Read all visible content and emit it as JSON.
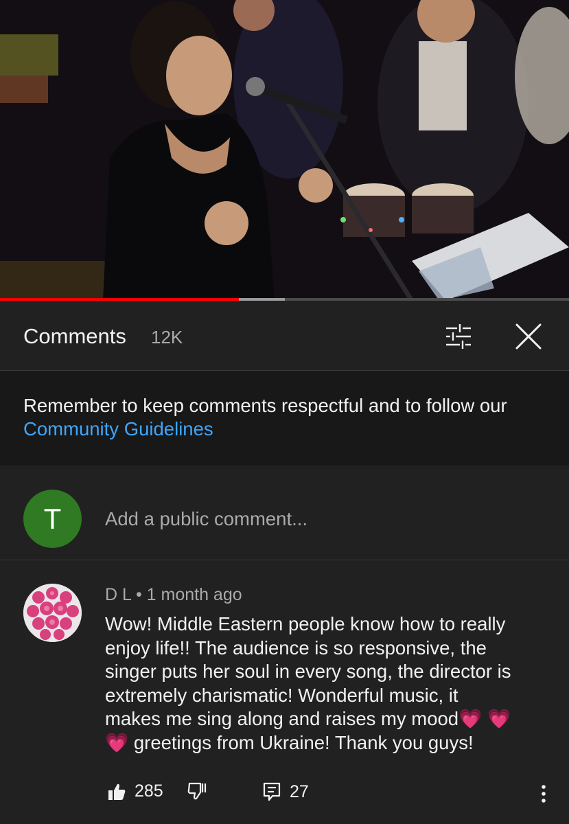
{
  "video": {
    "progress_played": 0.42,
    "progress_buffered": 0.5
  },
  "comments_panel": {
    "title": "Comments",
    "count": "12K"
  },
  "guidelines": {
    "text": "Remember to keep comments respectful and to follow our ",
    "link_label": "Community Guidelines"
  },
  "add_comment": {
    "avatar_initial": "T",
    "avatar_color": "#2f7a22",
    "placeholder": "Add a public comment..."
  },
  "comment": {
    "author": "D L",
    "separator": "•",
    "time": "1 month ago",
    "text_line_1": "Wow! Middle Eastern people know how to really",
    "text_line_2": "enjoy life!! The audience is so responsive, the",
    "text_line_3": "singer puts her soul in every song, the director is",
    "text_line_4": "extremely charismatic! Wonderful music, it",
    "text_line_5": "makes me sing along and raises my mood💗 💗",
    "text_line_6": "💗 greetings from Ukraine! Thank you guys!",
    "likes": "285",
    "replies": "27"
  },
  "colors": {
    "accent_link": "#3ea6ff",
    "progress": "#ff0000",
    "panel_bg": "#212121"
  },
  "icons": [
    "filter-icon",
    "close-icon",
    "thumbs-up-icon",
    "thumbs-down-icon",
    "reply-icon",
    "more-vert-icon"
  ]
}
